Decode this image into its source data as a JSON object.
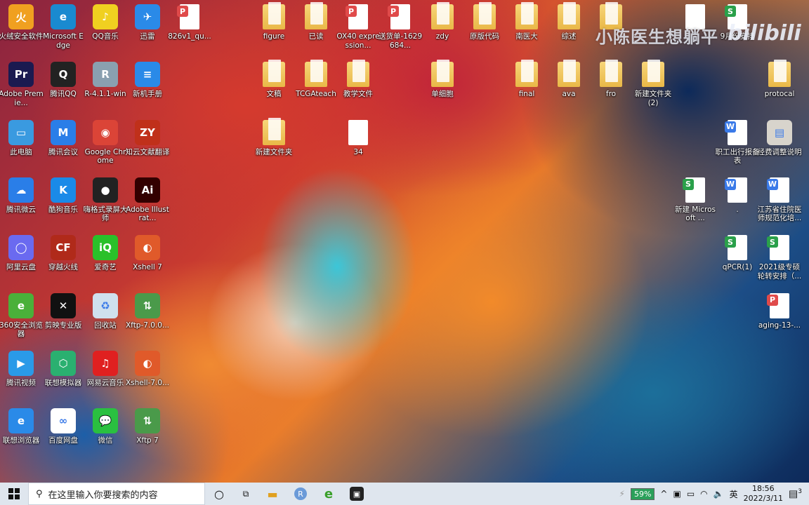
{
  "desktop": {
    "icons": [
      {
        "label": "火绒安全软件",
        "icon": "huorong-shield-icon",
        "color": "#f0a020",
        "txt": "火"
      },
      {
        "label": "Adobe Premie...",
        "icon": "premiere-icon",
        "color": "#1a1a50",
        "txt": "Pr"
      },
      {
        "label": "此电脑",
        "icon": "computer-icon",
        "color": "#3a9ae0",
        "txt": "▭"
      },
      {
        "label": "腾讯微云",
        "icon": "weiyun-icon",
        "color": "#2a7ee8",
        "txt": "☁"
      },
      {
        "label": "阿里云盘",
        "icon": "aliyun-drive-icon",
        "color": "#6a6af0",
        "txt": "◯"
      },
      {
        "label": "360安全浏览器",
        "icon": "360-browser-icon",
        "color": "#4ab03a",
        "txt": "e"
      },
      {
        "label": "腾讯视频",
        "icon": "tencent-video-icon",
        "color": "#2a9ae8",
        "txt": "▶"
      },
      {
        "label": "联想浏览器",
        "icon": "lenovo-browser-icon",
        "color": "#2a8ae8",
        "txt": "e"
      },
      {
        "label": "Microsoft Edge",
        "icon": "edge-icon",
        "color": "#1a8ad0",
        "txt": "e"
      },
      {
        "label": "腾讯QQ",
        "icon": "qq-penguin-icon",
        "color": "#222",
        "txt": "Q"
      },
      {
        "label": "腾讯会议",
        "icon": "tencent-meeting-icon",
        "color": "#2a7ee8",
        "txt": "M"
      },
      {
        "label": "酷狗音乐",
        "icon": "kugou-icon",
        "color": "#1a8ae8",
        "txt": "K"
      },
      {
        "label": "穿越火线",
        "icon": "crossfire-icon",
        "color": "#b02a1a",
        "txt": "CF"
      },
      {
        "label": "剪映专业版",
        "icon": "capcut-icon",
        "color": "#111",
        "txt": "✕"
      },
      {
        "label": "联想模拟器",
        "icon": "lenovo-emulator-icon",
        "color": "#2ab070",
        "txt": "⬡"
      },
      {
        "label": "百度网盘",
        "icon": "baidu-netdisk-icon",
        "color": "#fff",
        "txt": "∞"
      },
      {
        "label": "QQ音乐",
        "icon": "qq-music-icon",
        "color": "#f0d020",
        "txt": "♪"
      },
      {
        "label": "R-4.1.1-win",
        "icon": "installer-icon",
        "color": "#8aa0b0",
        "txt": "R"
      },
      {
        "label": "Google Chrome",
        "icon": "chrome-icon",
        "color": "#db4437",
        "txt": "◉"
      },
      {
        "label": "嗨格式录屏大师",
        "icon": "screen-recorder-icon",
        "color": "#222",
        "txt": "●"
      },
      {
        "label": "爱奇艺",
        "icon": "iqiyi-icon",
        "color": "#2ac02a",
        "txt": "iQ"
      },
      {
        "label": "回收站",
        "icon": "recycle-bin-icon",
        "color": "#cfe0ee",
        "txt": "♻"
      },
      {
        "label": "网易云音乐",
        "icon": "netease-music-icon",
        "color": "#e02020",
        "txt": "♫"
      },
      {
        "label": "微信",
        "icon": "wechat-icon",
        "color": "#2ac040",
        "txt": "💬"
      },
      {
        "label": "迅雷",
        "icon": "xunlei-icon",
        "color": "#2a8ae8",
        "txt": "✈"
      },
      {
        "label": "新机手册",
        "icon": "manual-icon",
        "color": "#2a8ae8",
        "txt": "≡"
      },
      {
        "label": "知云文献翻译",
        "icon": "zhiyun-icon",
        "color": "#c0301a",
        "txt": "ZY"
      },
      {
        "label": "Adobe Illustrat...",
        "icon": "illustrator-icon",
        "color": "#330000",
        "txt": "Ai"
      },
      {
        "label": "Xshell 7",
        "icon": "xshell-icon",
        "color": "#e05a2a",
        "txt": "◐"
      },
      {
        "label": "Xftp-7.0.0...",
        "icon": "xftp-installer-icon",
        "color": "#4a9a4a",
        "txt": "⇅"
      },
      {
        "label": "Xshell-7.0...",
        "icon": "xshell-installer-icon",
        "color": "#e05a2a",
        "txt": "◐"
      },
      {
        "label": "Xftp 7",
        "icon": "xftp-icon",
        "color": "#4a9a4a",
        "txt": "⇅"
      },
      {
        "label": "826v1_qu...",
        "icon": "pdf-file-icon",
        "type": "doc",
        "badge": "#e04a4a",
        "txt": "P"
      },
      {
        "label": "figure",
        "icon": "folder-icon",
        "type": "folder"
      },
      {
        "label": "文稿",
        "icon": "folder-icon",
        "type": "folder"
      },
      {
        "label": "新建文件夹",
        "icon": "folder-icon",
        "type": "folder"
      },
      {
        "label": "已读",
        "icon": "folder-icon",
        "type": "folder"
      },
      {
        "label": "TCGAteach",
        "icon": "folder-icon",
        "type": "folder"
      },
      {
        "label": "OX40 expression...",
        "icon": "pdf-file-icon",
        "type": "doc",
        "badge": "#e04a4a",
        "txt": "P"
      },
      {
        "label": "教学文件",
        "icon": "folder-icon",
        "type": "folder"
      },
      {
        "label": "34",
        "icon": "blank-file-icon",
        "type": "doc"
      },
      {
        "label": "送货单-1629684...",
        "icon": "pdf-file-icon",
        "type": "doc",
        "badge": "#e04a4a",
        "txt": "P"
      },
      {
        "label": "zdy",
        "icon": "folder-icon",
        "type": "folder"
      },
      {
        "label": "单细胞",
        "icon": "folder-icon",
        "type": "folder"
      },
      {
        "label": "原版代码",
        "icon": "folder-icon",
        "type": "folder"
      },
      {
        "label": "南医大",
        "icon": "folder-icon",
        "type": "folder"
      },
      {
        "label": "final",
        "icon": "folder-icon",
        "type": "folder"
      },
      {
        "label": "综述",
        "icon": "folder-icon",
        "type": "folder"
      },
      {
        "label": "ava",
        "icon": "folder-icon",
        "type": "folder"
      },
      {
        "label": "",
        "icon": "folder-icon",
        "type": "folder"
      },
      {
        "label": "fro",
        "icon": "folder-icon",
        "type": "folder"
      },
      {
        "label": "新建文件夹 (2)",
        "icon": "folder-icon",
        "type": "folder"
      },
      {
        "label": "",
        "icon": "blank-file-icon",
        "type": "doc"
      },
      {
        "label": "新建 Microsoft ...",
        "icon": "spreadsheet-file-icon",
        "type": "doc",
        "badge": "#2aa04a",
        "txt": "S"
      },
      {
        "label": "9月份安排",
        "icon": "spreadsheet-file-icon",
        "type": "doc",
        "badge": "#2aa04a",
        "txt": "S"
      },
      {
        "label": "职工出行报备表",
        "icon": "word-file-icon",
        "type": "doc",
        "badge": "#3a7ae8",
        "txt": "W"
      },
      {
        "label": ".",
        "icon": "word-file-icon",
        "type": "doc",
        "badge": "#3a7ae8",
        "txt": "W"
      },
      {
        "label": "qPCR(1)",
        "icon": "spreadsheet-file-icon",
        "type": "doc",
        "badge": "#2aa04a",
        "txt": "S"
      },
      {
        "label": "protocal",
        "icon": "folder-icon",
        "type": "folder"
      },
      {
        "label": "经费调整说明",
        "icon": "image-file-icon",
        "color": "#d8d4cc",
        "txt": "▤"
      },
      {
        "label": "江苏省住院医师规范化培...",
        "icon": "word-file-icon",
        "type": "doc",
        "badge": "#3a7ae8",
        "txt": "W"
      },
      {
        "label": "2021级专硕轮转安排（...",
        "icon": "spreadsheet-file-icon",
        "type": "doc",
        "badge": "#2aa04a",
        "txt": "S"
      },
      {
        "label": "aging-13-...",
        "icon": "pdf-file-icon",
        "type": "doc",
        "badge": "#e04a4a",
        "txt": "P"
      }
    ]
  },
  "watermark": {
    "text": "小陈医生想躺平",
    "logo": "bilibili"
  },
  "taskbar": {
    "search_placeholder": "在这里输入你要搜索的内容",
    "battery": "59%",
    "ime": "英",
    "time": "18:56",
    "date": "2022/3/11",
    "notifications": "3"
  }
}
